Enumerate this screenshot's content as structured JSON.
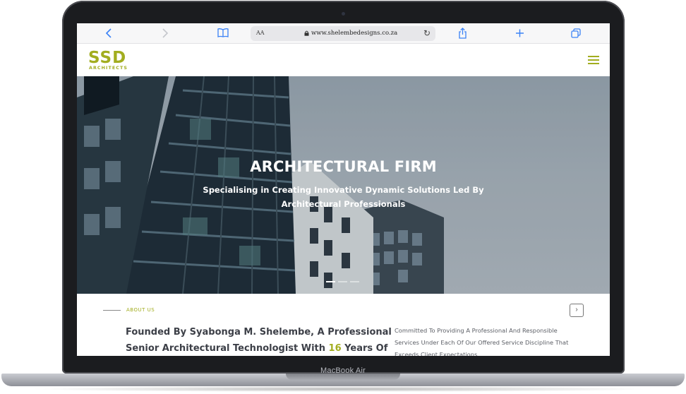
{
  "device": {
    "label": "MacBook Air"
  },
  "browser": {
    "address_prefix": "AA",
    "url": "www.shelembedesigns.co.za",
    "icons": [
      "back-icon",
      "forward-icon",
      "bookmarks-icon",
      "lock-icon",
      "reload-icon",
      "share-icon",
      "new-tab-icon",
      "tabs-icon"
    ]
  },
  "site": {
    "logo_letters": "SSD",
    "logo_sub": "ARCHITECTS",
    "accent_color": "#a2ad1f",
    "menu_icon": "hamburger-icon"
  },
  "hero": {
    "title": "ARCHITECTURAL FIRM",
    "subtitle": "Specialising in Creating Innovative Dynamic Solutions Led By Architectural Professionals",
    "slides_total": 3,
    "active_slide": 1
  },
  "about": {
    "tag": "ABOUT US",
    "heading_before": "Founded By Syabonga M. Shelembe, A Professional Senior Architectural Technologist With ",
    "heading_highlight": "16",
    "heading_after": " Years Of",
    "text": "Committed To Providing A Professional And Responsible Services Under Each Of Our Offered Service Discipline That Exceeds Client Expectations.",
    "next_icon": "chevron-right-icon"
  }
}
